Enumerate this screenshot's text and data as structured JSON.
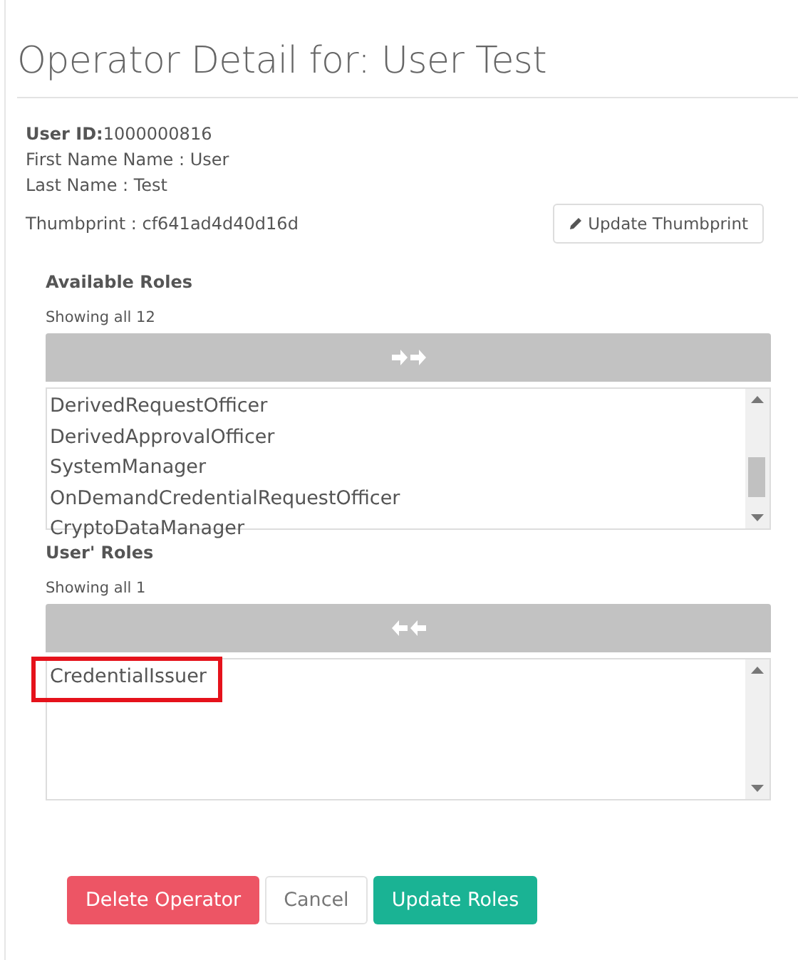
{
  "title": "Operator Detail for: User Test",
  "user": {
    "id_label": "User ID:",
    "id_value": "1000000816",
    "lines": [
      "First Name Name : User",
      "Last Name : Test"
    ],
    "thumbprint": "Thumbprint : cf641ad4d40d16d"
  },
  "thumbprint_button": {
    "label": "Update Thumbprint"
  },
  "lists": [
    {
      "heading": "Available Roles",
      "count": "Showing all 12",
      "kind": "add",
      "items": [
        {
          "label": "DerivedRequestOfficer",
          "highlighted": false
        },
        {
          "label": "DerivedApprovalOfficer",
          "highlighted": false
        },
        {
          "label": "SystemManager",
          "highlighted": false
        },
        {
          "label": "OnDemandCredentialRequestOfficer",
          "highlighted": false
        },
        {
          "label": "CryptoDataManager",
          "highlighted": false
        }
      ]
    },
    {
      "heading": "User' Roles",
      "count": "Showing all 1",
      "kind": "remove",
      "items": [
        {
          "label": "CredentialIssuer",
          "highlighted": true
        }
      ]
    }
  ],
  "buttons": [
    {
      "label": "Delete Operator",
      "kind": "danger"
    },
    {
      "label": "Cancel",
      "kind": "default"
    },
    {
      "label": "Update Roles",
      "kind": "success"
    }
  ]
}
